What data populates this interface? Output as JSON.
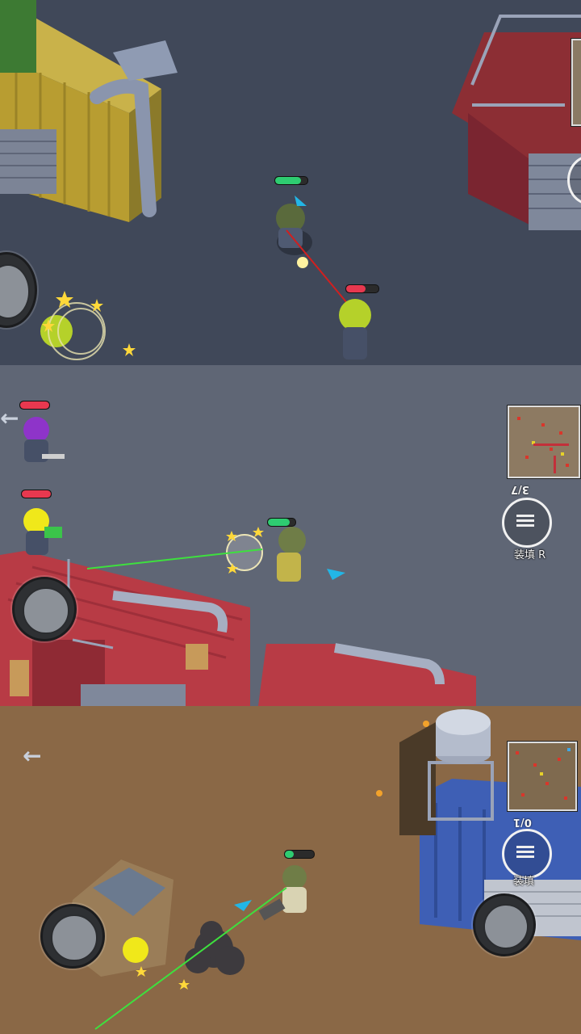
{
  "panels": [
    {
      "id": "top",
      "player": {
        "health": 0.8,
        "health_color": "#2ecc71"
      },
      "enemies": [
        {
          "health": 0.6,
          "health_color": "#e8384f"
        }
      ]
    },
    {
      "id": "middle",
      "ammo": "3/7",
      "reload_label": "装填 R",
      "player": {
        "health": 0.8,
        "health_color": "#2ecc71"
      },
      "enemies": [
        {
          "health": 1.0,
          "health_color": "#e8384f"
        },
        {
          "health": 1.0,
          "health_color": "#e8384f"
        }
      ]
    },
    {
      "id": "bottom",
      "ammo": "0/1",
      "reload_label": "装填",
      "player": {
        "health": 0.3,
        "health_color": "#2ecc71"
      }
    }
  ],
  "colors": {
    "enemy_health": "#e8384f",
    "player_health": "#2ecc71",
    "aim_laser_red": "#d11f1f",
    "aim_laser_green": "#3ee03e",
    "direction_marker": "#22b6e6"
  },
  "icons": {
    "back": "arrow-left-icon",
    "reload": "reload-cycle-icon",
    "joystick": "joystick-icon"
  }
}
